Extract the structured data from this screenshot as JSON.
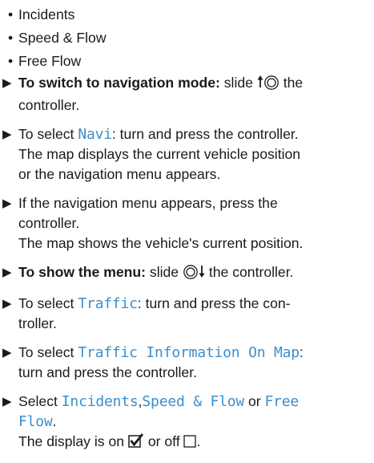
{
  "options": [
    "Incidents",
    "Speed & Flow",
    "Free Flow"
  ],
  "steps": [
    {
      "lead": "To switch to navigation mode:",
      "text_before": "slide",
      "text_after": "the",
      "line2": "controller."
    },
    {
      "text_before": "To select ",
      "display": "Navi",
      "text_after": ": turn and press the controller.",
      "line2": "The map displays the current vehicle position",
      "line3": "or the navigation menu appears."
    },
    {
      "line1": "If the navigation menu appears, press the",
      "line2": "controller.",
      "result": "The map shows the vehicle's current position."
    },
    {
      "lead": "To show the menu:",
      "text_before": "slide",
      "text_after": "the controller."
    },
    {
      "text_before": "To select ",
      "display": "Traffic",
      "text_after": ": turn and press the con-",
      "line2": "troller."
    },
    {
      "text_before": "To select ",
      "display": "Traffic Information On Map",
      "text_after": ":",
      "line2": "turn and press the controller."
    },
    {
      "select": "Select",
      "opt1": "Incidents",
      "sep": ",",
      "opt2": "Speed & Flow",
      "or": "or",
      "opt3a": "Free",
      "opt3b": "Flow",
      "end": ".",
      "result_before": "The display is on",
      "result_mid": "or off",
      "result_end": "."
    }
  ],
  "colors": {
    "display_text": "#3a8fcf",
    "body_text": "#1a1a1a"
  },
  "icons": [
    "step-arrow-icon",
    "controller-slide-up-icon",
    "controller-slide-down-icon",
    "checkbox-checked-icon",
    "checkbox-unchecked-icon"
  ]
}
